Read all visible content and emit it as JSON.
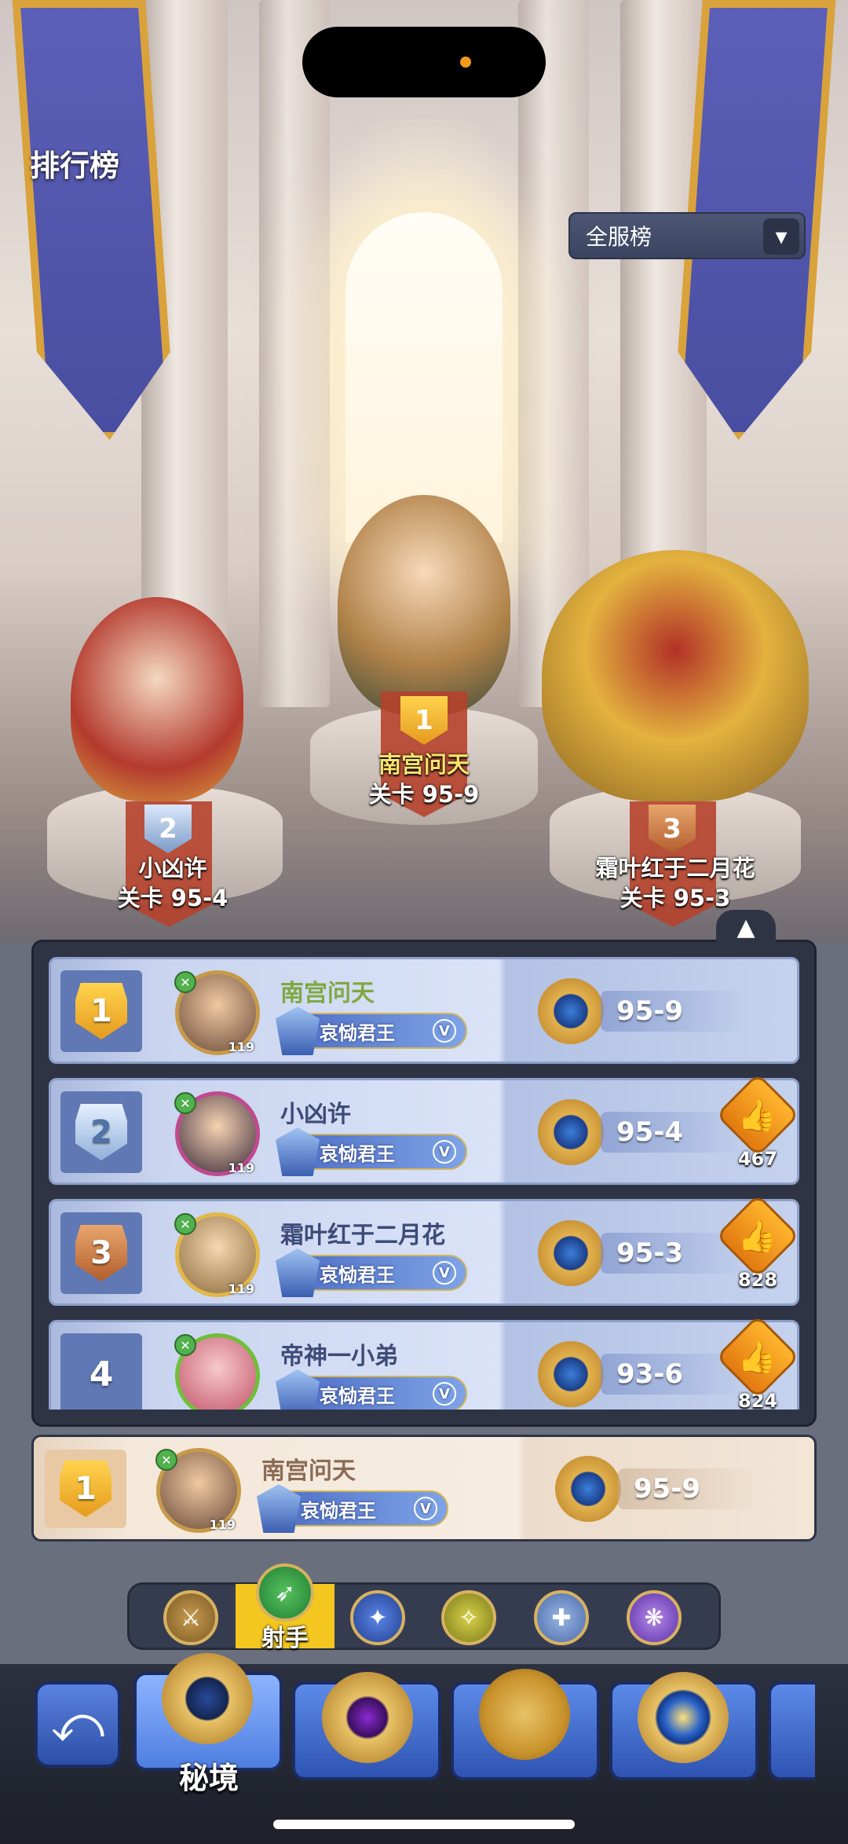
{
  "header": {
    "title": "排行榜",
    "server_dropdown": {
      "selected": "全服榜",
      "caret_icon": "chevron-down-icon"
    }
  },
  "podium": [
    {
      "rank": "2",
      "name": "小凶许",
      "stage_text": "关卡 95-4"
    },
    {
      "rank": "1",
      "name": "南宫问天",
      "stage_text": "关卡 95-9"
    },
    {
      "rank": "3",
      "name": "霜叶红于二月花",
      "stage_text": "关卡 95-3"
    }
  ],
  "leaderboard": {
    "collapse_icon": "chevron-up-icon",
    "rows": [
      {
        "rank": "1",
        "medal": "gold",
        "name": "南宫问天",
        "level": "119",
        "title": "哀恸君王",
        "title_tier": "V",
        "stage": "95-9",
        "likes": null
      },
      {
        "rank": "2",
        "medal": "silver",
        "name": "小凶许",
        "level": "119",
        "title": "哀恸君王",
        "title_tier": "V",
        "stage": "95-4",
        "likes": "467"
      },
      {
        "rank": "3",
        "medal": "bronze",
        "name": "霜叶红于二月花",
        "level": "119",
        "title": "哀恸君王",
        "title_tier": "V",
        "stage": "95-3",
        "likes": "828"
      },
      {
        "rank": "4",
        "medal": "none",
        "name": "帝神一小弟",
        "level": "",
        "title": "哀恸君王",
        "title_tier": "V",
        "stage": "93-6",
        "likes": "824"
      }
    ]
  },
  "my_rank": {
    "rank": "1",
    "name": "南宫问天",
    "level": "119",
    "title": "哀恸君王",
    "title_tier": "V",
    "stage": "95-9"
  },
  "class_filter": {
    "selected_label": "射手",
    "classes": [
      "warrior-icon",
      "archer-icon",
      "mage-icon",
      "assassin-icon",
      "support-icon",
      "summoner-icon"
    ]
  },
  "mode_bar": {
    "active_label": "秘境",
    "back_icon": "back-arrow-icon"
  },
  "colors": {
    "panel": "#2f3445",
    "row_blue": "#c9d4ef",
    "my_row": "#f3e8da",
    "accent_gold": "#d7b260",
    "like_orange": "#f0961e",
    "active_class": "#f3c71f"
  }
}
